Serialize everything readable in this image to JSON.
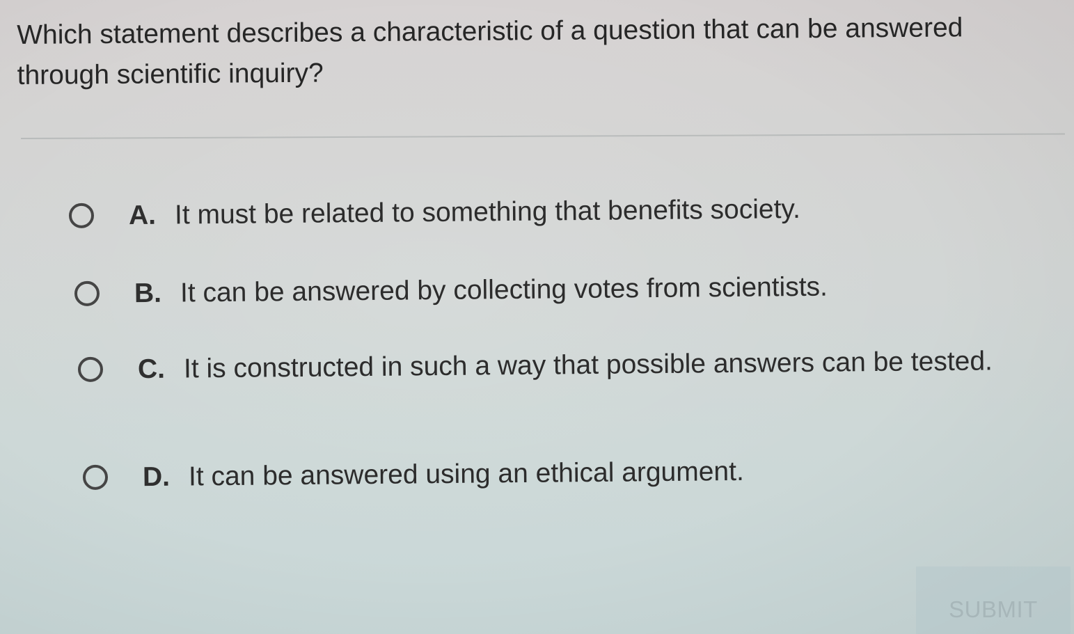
{
  "question": {
    "text": "Which statement describes a characteristic of a question that can be answered through scientific inquiry?"
  },
  "options": [
    {
      "letter": "A.",
      "text": "It must be related to something that benefits society.",
      "selected": false
    },
    {
      "letter": "B.",
      "text": "It can be answered by collecting votes from scientists.",
      "selected": false
    },
    {
      "letter": "C.",
      "text": "It is constructed in such a way that possible answers can be tested.",
      "selected": false
    },
    {
      "letter": "D.",
      "text": "It can be answered using an ethical argument.",
      "selected": false
    }
  ],
  "submit": {
    "label": "SUBMIT",
    "state": "disabled"
  },
  "colors": {
    "text": "#2b2b2b",
    "radio_border": "#454545",
    "submit_text": "#a7b6b9"
  },
  "icons": {
    "radio": "radio-unchecked-icon"
  }
}
